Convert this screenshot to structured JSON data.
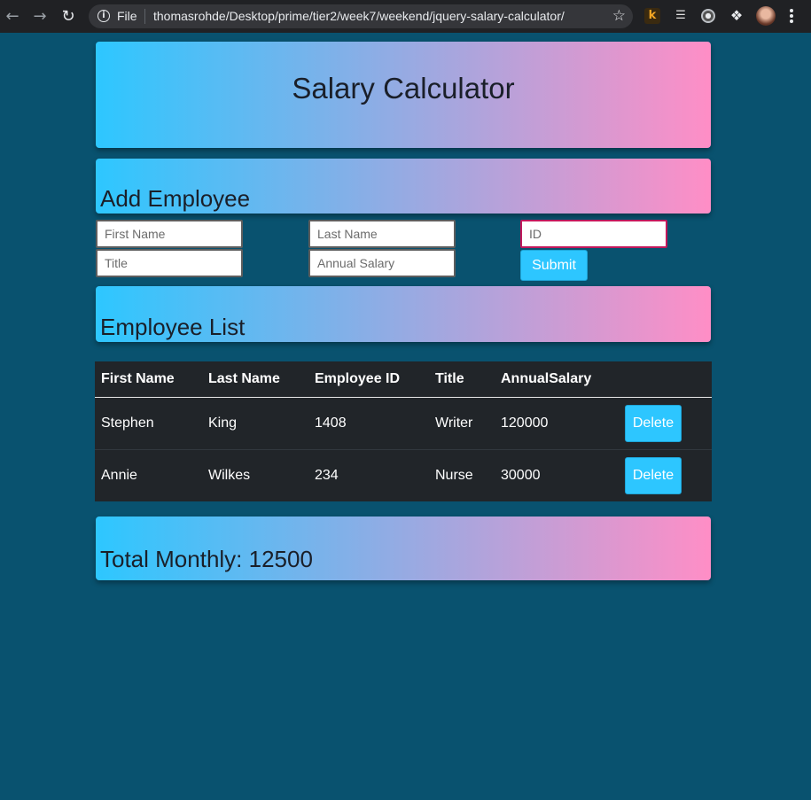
{
  "browser": {
    "file_label": "File",
    "url": "thomasrohde/Desktop/prime/tier2/week7/weekend/jquery-salary-calculator/",
    "icons": {
      "back": "back-arrow-icon",
      "forward": "forward-arrow-icon",
      "reload": "reload-icon",
      "info": "info-icon",
      "bookmark": "star-icon",
      "extensions": "puzzle-icon"
    },
    "extension_k_label": "k"
  },
  "page": {
    "title": "Salary Calculator",
    "add_employee": {
      "heading": "Add Employee",
      "first_name_placeholder": "First Name",
      "last_name_placeholder": "Last Name",
      "id_placeholder": "ID",
      "title_placeholder": "Title",
      "annual_salary_placeholder": "Annual Salary",
      "submit_label": "Submit"
    },
    "employee_list": {
      "heading": "Employee List",
      "columns": [
        "First Name",
        "Last Name",
        "Employee ID",
        "Title",
        "AnnualSalary",
        ""
      ],
      "rows": [
        {
          "first_name": "Stephen",
          "last_name": "King",
          "employee_id": "1408",
          "title": "Writer",
          "annual_salary": "120000",
          "action": "Delete"
        },
        {
          "first_name": "Annie",
          "last_name": "Wilkes",
          "employee_id": "234",
          "title": "Nurse",
          "annual_salary": "30000",
          "action": "Delete"
        }
      ]
    },
    "total_monthly": "Total Monthly: 12500"
  },
  "colors": {
    "page_background": "#09526f",
    "gradient_start": "#2dc7ff",
    "gradient_end": "#ff8ec6",
    "button": "#2dc6ff",
    "table_background": "#212529",
    "focus_border": "#c2185b"
  }
}
